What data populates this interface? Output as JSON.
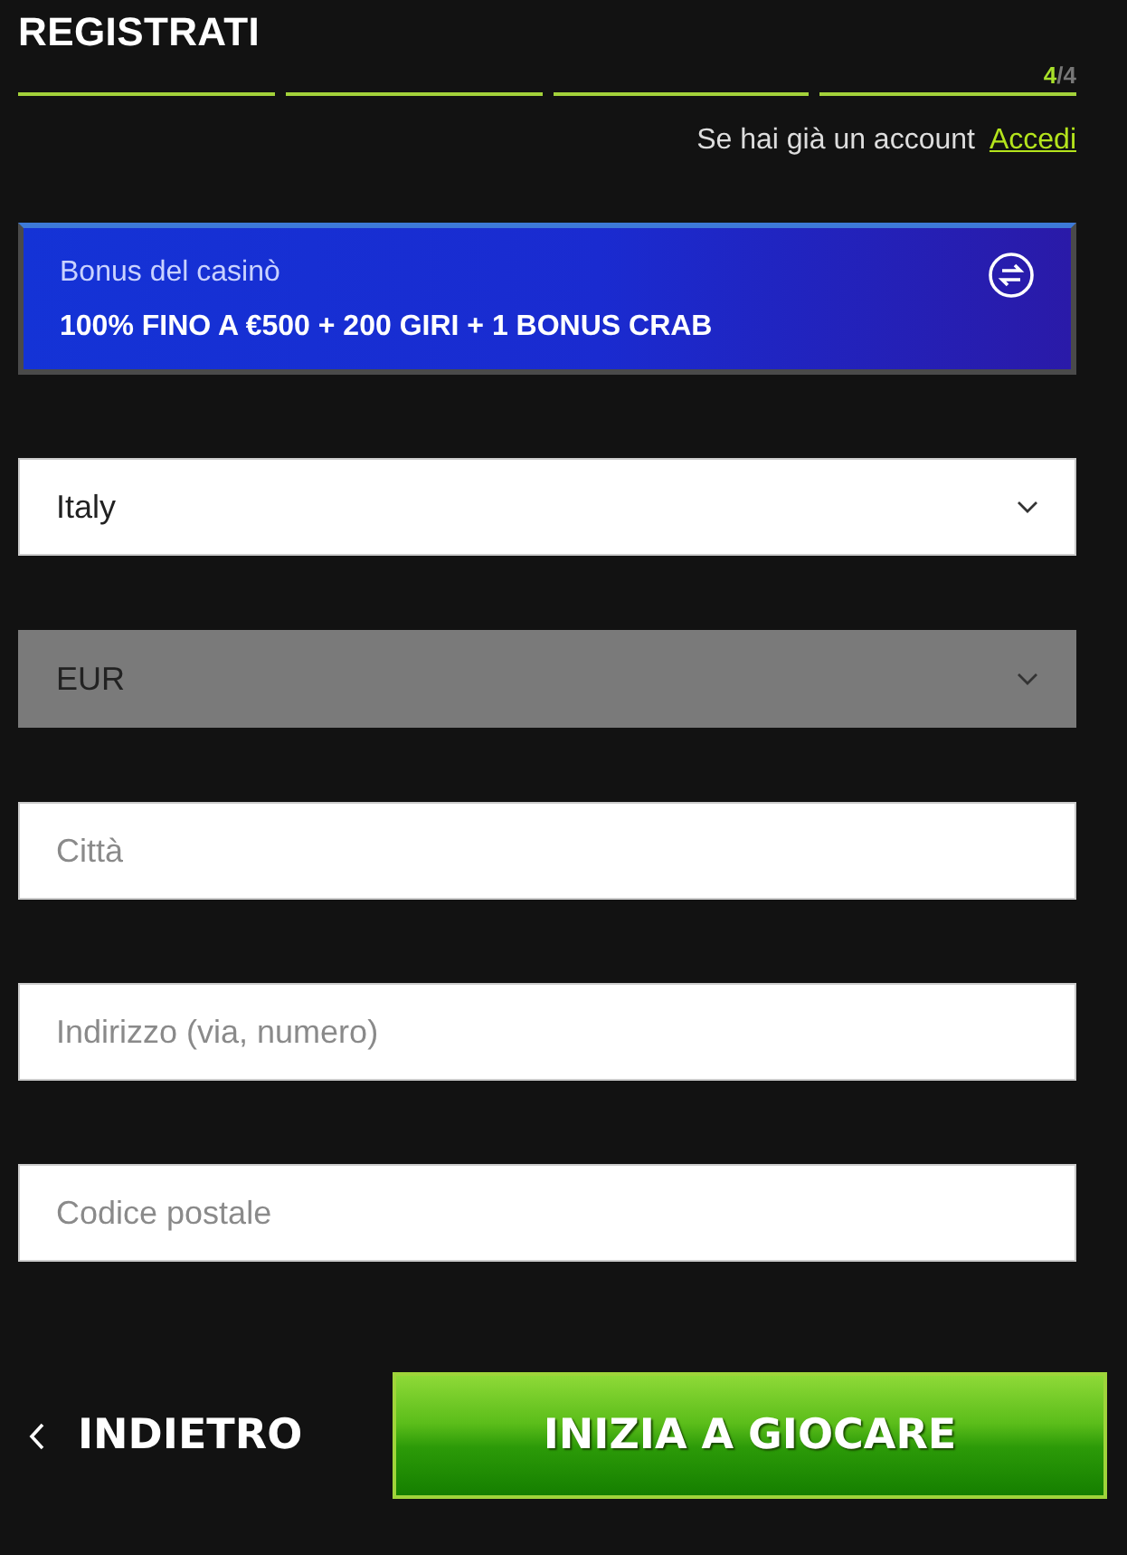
{
  "title": "REGISTRATI",
  "progress": {
    "segments": [
      {
        "done": true
      },
      {
        "done": true
      },
      {
        "done": true
      },
      {
        "done": true
      }
    ],
    "current": "4",
    "separator": "/",
    "total": "4"
  },
  "login_prompt": {
    "text": "Se hai già un account",
    "link": "Accedi"
  },
  "bonus": {
    "label": "Bonus del casinò",
    "offer": "100% FINO A €500 + 200 GIRI + 1 BONUS CRAB"
  },
  "fields": [
    {
      "kind": "select",
      "value": "Italy",
      "disabled": false
    },
    {
      "kind": "select",
      "value": "EUR",
      "disabled": true
    },
    {
      "kind": "text",
      "placeholder": "Città"
    },
    {
      "kind": "text",
      "placeholder": "Indirizzo (via, numero)"
    },
    {
      "kind": "text",
      "placeholder": "Codice postale"
    }
  ],
  "back_button": {
    "label": "INDIETRO"
  },
  "submit_button": {
    "label": "INIZIA A GIOCARE"
  }
}
